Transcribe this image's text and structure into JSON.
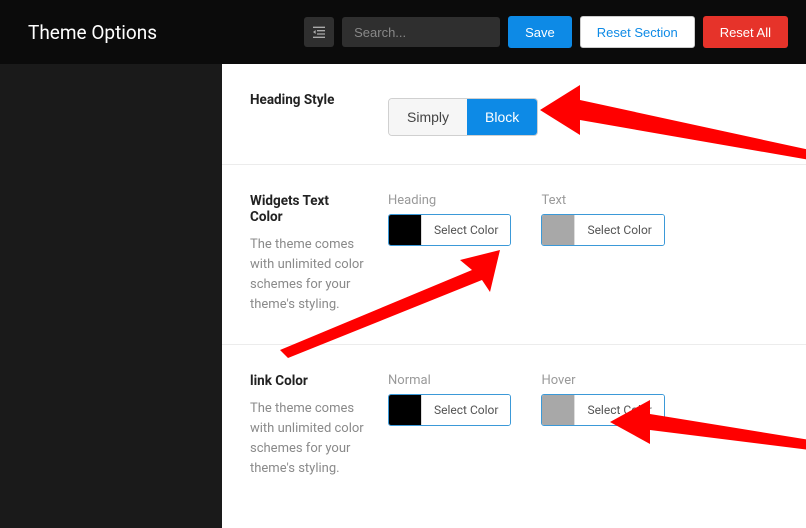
{
  "header": {
    "title": "Theme Options",
    "search_placeholder": "Search...",
    "save_label": "Save",
    "reset_section_label": "Reset Section",
    "reset_all_label": "Reset All"
  },
  "sections": {
    "heading_style": {
      "title": "Heading Style",
      "options": {
        "simply": "Simply",
        "block": "Block"
      },
      "active": "block"
    },
    "widgets_text_color": {
      "title": "Widgets Text Color",
      "desc": "The theme comes with unlimited color schemes for your theme's styling.",
      "heading_label": "Heading",
      "text_label": "Text",
      "select_color_label": "Select Color",
      "heading_color": "#000000",
      "text_color": "#a8a8a8"
    },
    "link_color": {
      "title": "link Color",
      "desc": "The theme comes with unlimited color schemes for your theme's styling.",
      "normal_label": "Normal",
      "hover_label": "Hover",
      "select_color_label": "Select Color",
      "normal_color": "#000000",
      "hover_color": "#a8a8a8"
    }
  }
}
